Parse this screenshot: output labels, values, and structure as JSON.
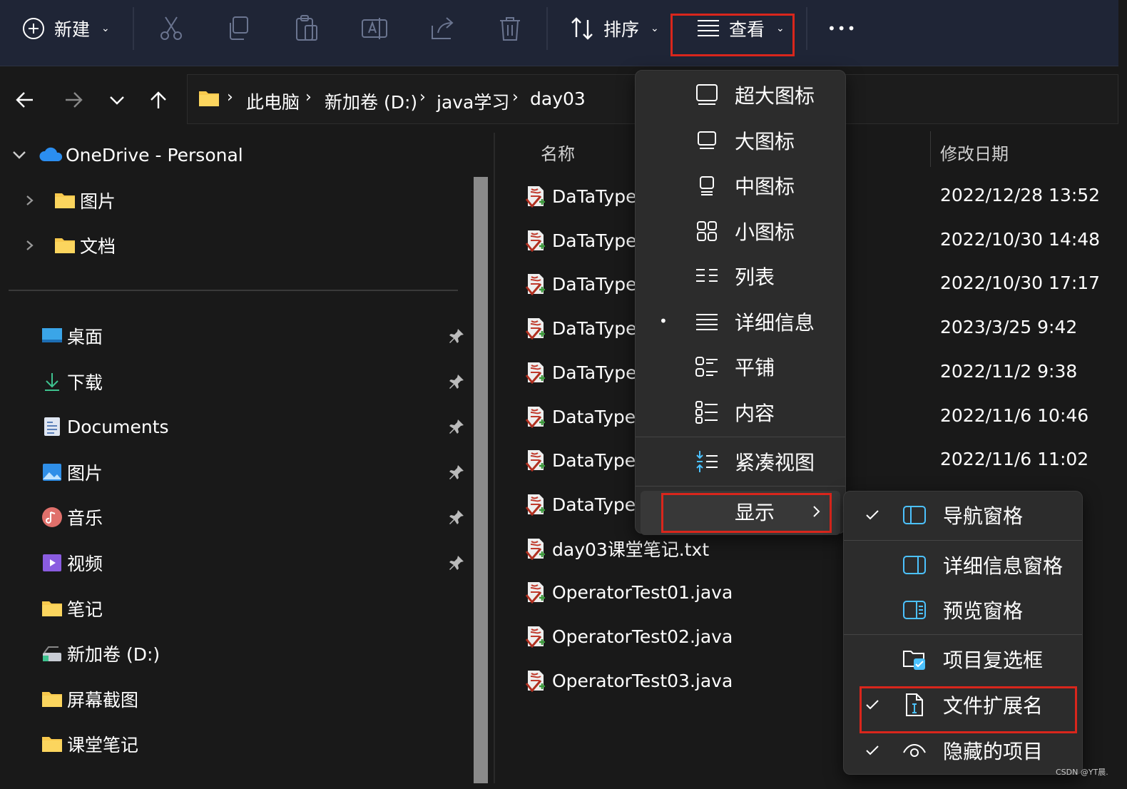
{
  "toolbar": {
    "new_label": "新建",
    "sort_label": "排序",
    "view_label": "查看",
    "more_label": "•••"
  },
  "breadcrumb": [
    "此电脑",
    "新加卷 (D:)",
    "java学习",
    "day03"
  ],
  "sidebar": {
    "onedrive": "OneDrive - Personal",
    "onedrive_children": [
      "图片",
      "文档"
    ],
    "quick_access": [
      "桌面",
      "下载",
      "Documents",
      "图片",
      "音乐",
      "视频",
      "笔记",
      "新加卷 (D:)",
      "屏幕截图",
      "课堂笔记"
    ]
  },
  "columns": {
    "name": "名称",
    "modified": "修改日期"
  },
  "files": [
    {
      "name": "DaTaType",
      "date": "2022/12/28 13:52"
    },
    {
      "name": "DaTaType",
      "date": "2022/10/30 14:48"
    },
    {
      "name": "DaTaType",
      "date": "2022/10/30 17:17"
    },
    {
      "name": "DaTaType",
      "date": "2023/3/25 9:42"
    },
    {
      "name": "DaTaType",
      "date": "2022/11/2 9:38"
    },
    {
      "name": "DataTypeT",
      "date": "2022/11/6 10:46"
    },
    {
      "name": "DataTypeT",
      "date": "2022/11/6 11:02"
    },
    {
      "name": "DataTypeT",
      "date": ""
    },
    {
      "name": "day03课堂笔记.txt",
      "date": ""
    },
    {
      "name": "OperatorTest01.java",
      "date": ""
    },
    {
      "name": "OperatorTest02.java",
      "date": ""
    },
    {
      "name": "OperatorTest03.java",
      "date": ""
    }
  ],
  "view_menu": {
    "items": [
      "超大图标",
      "大图标",
      "中图标",
      "小图标",
      "列表",
      "详细信息",
      "平铺",
      "内容"
    ],
    "selected": "详细信息",
    "compact": "紧凑视图",
    "show": "显示"
  },
  "show_menu": {
    "items": [
      {
        "label": "导航窗格",
        "checked": true
      },
      {
        "label": "详细信息窗格",
        "checked": false
      },
      {
        "label": "预览窗格",
        "checked": false
      },
      {
        "label": "项目复选框",
        "checked": false
      },
      {
        "label": "文件扩展名",
        "checked": true
      },
      {
        "label": "隐藏的项目",
        "checked": true
      }
    ]
  },
  "watermark": "CSDN @YT晨.",
  "colors": {
    "toolbar_bg": "#1f2536",
    "highlight": "#d9261c",
    "accent": "#4cc2ff"
  }
}
